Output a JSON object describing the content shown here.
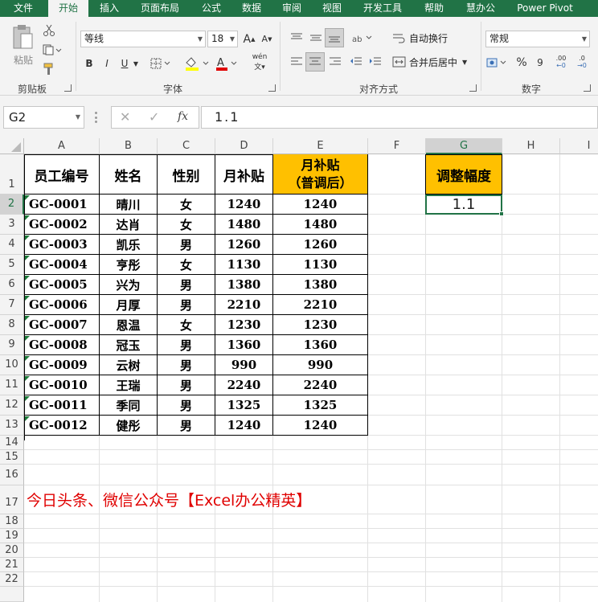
{
  "tabs": [
    "文件",
    "开始",
    "插入",
    "页面布局",
    "公式",
    "数据",
    "审阅",
    "视图",
    "开发工具",
    "帮助",
    "慧办公",
    "Power Pivot"
  ],
  "ribbon": {
    "clipboard": {
      "paste": "粘贴",
      "label": "剪贴板"
    },
    "font": {
      "name": "等线",
      "size": "18",
      "bold": "B",
      "italic": "I",
      "underline": "U",
      "grow": "A",
      "shrink": "A",
      "phonetic": "wén",
      "label": "字体"
    },
    "alignment": {
      "wrap": "自动换行",
      "merge": "合并后居中",
      "label": "对齐方式"
    },
    "number": {
      "format": "常规",
      "percent": "%",
      "comma": "9",
      "inc_dec": ".00",
      "dec_dec": ".0",
      "label": "数字"
    }
  },
  "formula_bar": {
    "name_box": "G2",
    "fx": "fx",
    "value": "1.1"
  },
  "columns": [
    "A",
    "B",
    "C",
    "D",
    "E",
    "F",
    "G",
    "H",
    "I"
  ],
  "rows": [
    "1",
    "2",
    "3",
    "4",
    "5",
    "6",
    "7",
    "8",
    "9",
    "10",
    "11",
    "12",
    "13",
    "14",
    "15",
    "16",
    "17",
    "18",
    "19",
    "20",
    "21",
    "22"
  ],
  "table": {
    "headers": [
      "员工编号",
      "姓名",
      "性别",
      "月补贴"
    ],
    "header_e": [
      "月补贴",
      "（普调后）"
    ],
    "data": [
      [
        "GC-0001",
        "晴川",
        "女",
        "1240",
        "1240"
      ],
      [
        "GC-0002",
        "达肖",
        "女",
        "1480",
        "1480"
      ],
      [
        "GC-0003",
        "凯乐",
        "男",
        "1260",
        "1260"
      ],
      [
        "GC-0004",
        "亨彤",
        "女",
        "1130",
        "1130"
      ],
      [
        "GC-0005",
        "兴为",
        "男",
        "1380",
        "1380"
      ],
      [
        "GC-0006",
        "月厚",
        "男",
        "2210",
        "2210"
      ],
      [
        "GC-0007",
        "恩温",
        "女",
        "1230",
        "1230"
      ],
      [
        "GC-0008",
        "冠玉",
        "男",
        "1360",
        "1360"
      ],
      [
        "GC-0009",
        "云树",
        "男",
        "990",
        "990"
      ],
      [
        "GC-0010",
        "王瑞",
        "男",
        "2240",
        "2240"
      ],
      [
        "GC-0011",
        "季同",
        "男",
        "1325",
        "1325"
      ],
      [
        "GC-0012",
        "健彤",
        "男",
        "1240",
        "1240"
      ]
    ]
  },
  "adjust": {
    "label": "调整幅度",
    "value": "1.1"
  },
  "note": "今日头条、微信公众号【Excel办公精英】",
  "colors": {
    "excel_green": "#217346",
    "highlight": "#ffc000",
    "note_red": "#e00000"
  }
}
